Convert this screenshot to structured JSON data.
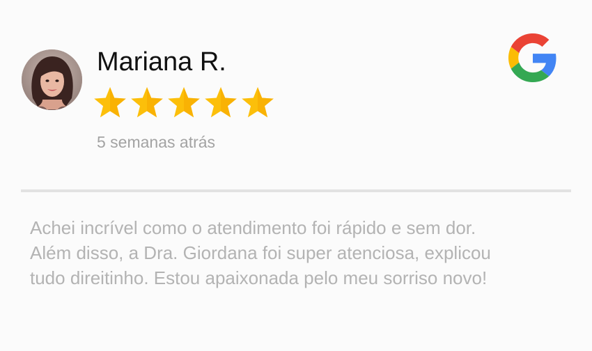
{
  "reviewer": {
    "name": "Mariana R.",
    "avatar_icon": "user-photo-avatar"
  },
  "rating": {
    "value": 5,
    "max": 5,
    "star_color": "#fcbf0a"
  },
  "time_ago": "5 semanas atrás",
  "source_icon": "google-g-icon",
  "review": {
    "lines": [
      "Achei incrível como o atendimento foi rápido e sem dor.",
      "Além disso, a Dra. Giordana foi super atenciosa, explicou",
      "tudo direitinho. Estou apaixonada pelo meu sorriso novo!"
    ]
  },
  "colors": {
    "name_text": "#111111",
    "muted_text": "#a3a3a3",
    "review_text": "#b3b3b3",
    "divider": "#e2e2e2",
    "background": "#fbfbfb"
  }
}
